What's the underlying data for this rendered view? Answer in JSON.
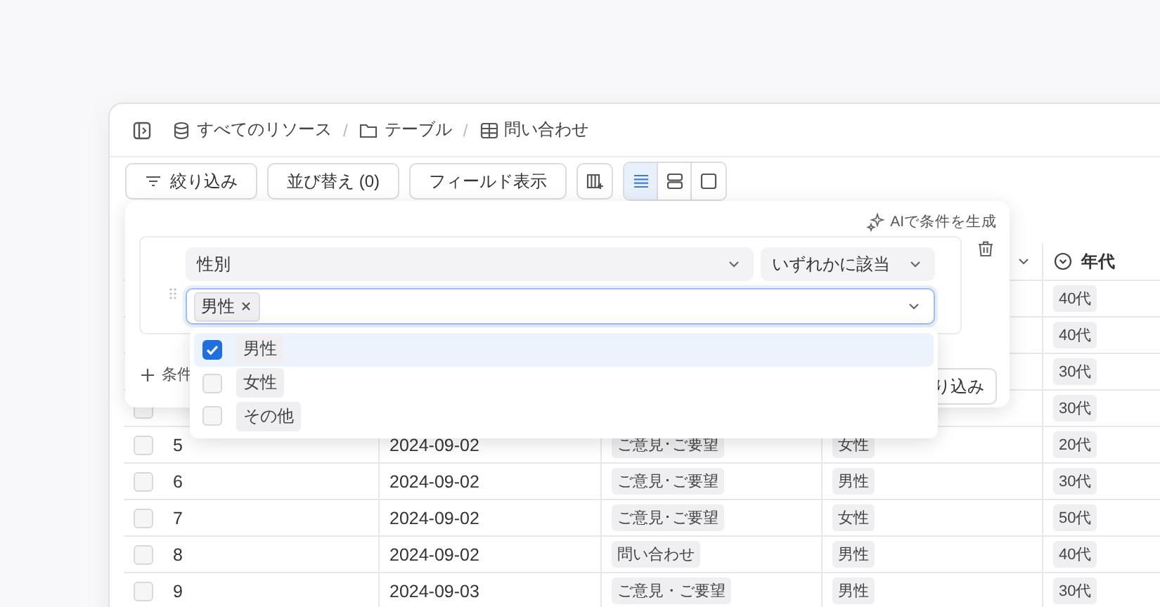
{
  "breadcrumb": [
    {
      "kind": "db",
      "label": "すべてのリソース"
    },
    {
      "kind": "folder",
      "label": "テーブル"
    },
    {
      "kind": "table",
      "label": "問い合わせ"
    }
  ],
  "breadcrumb_separator": "/",
  "toolbar": {
    "filter": "絞り込み",
    "sort": "並び替え (0)",
    "fields": "フィールド表示",
    "views": [
      {
        "kind": "list",
        "selected": true
      },
      {
        "kind": "rows",
        "selected": false
      },
      {
        "kind": "card",
        "selected": false
      }
    ]
  },
  "table": {
    "columns": [
      {
        "label": "年代"
      }
    ],
    "rows": [
      {
        "age": "40代"
      },
      {
        "age": "40代"
      },
      {
        "age": "30代"
      },
      {
        "checked": false,
        "age": "30代"
      },
      {
        "checked": false,
        "no": "5",
        "date": "2024-09-02",
        "category": "ご意見･ご要望",
        "gender": "女性",
        "age": "20代"
      },
      {
        "checked": false,
        "no": "6",
        "date": "2024-09-02",
        "category": "ご意見･ご要望",
        "gender": "男性",
        "age": "30代"
      },
      {
        "checked": false,
        "no": "7",
        "date": "2024-09-02",
        "category": "ご意見･ご要望",
        "gender": "女性",
        "age": "50代"
      },
      {
        "checked": false,
        "no": "8",
        "date": "2024-09-02",
        "category": "問い合わせ",
        "gender": "男性",
        "age": "40代"
      },
      {
        "checked": false,
        "no": "9",
        "date": "2024-09-03",
        "category": "ご意見・ご要望",
        "gender": "男性",
        "age": "30代"
      }
    ]
  },
  "filter_popover": {
    "ai_link": "AIで条件を生成",
    "field": "性別",
    "operator": "いずれかに該当",
    "chips": [
      "男性"
    ],
    "add_condition": "条件",
    "apply_button": "り込み"
  },
  "dropdown": {
    "options": [
      {
        "label": "男性",
        "checked": true,
        "selected": true
      },
      {
        "label": "女性",
        "checked": false,
        "selected": false
      },
      {
        "label": "その他",
        "checked": false,
        "selected": false
      }
    ]
  }
}
